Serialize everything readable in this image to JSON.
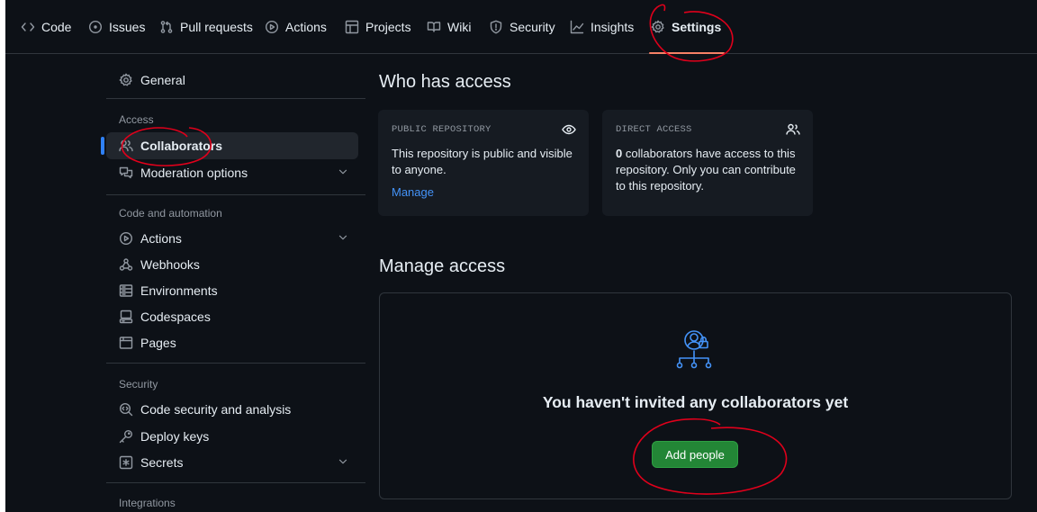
{
  "nav": {
    "tabs": [
      {
        "label": "Code",
        "icon": "code-icon"
      },
      {
        "label": "Issues",
        "icon": "issue-icon"
      },
      {
        "label": "Pull requests",
        "icon": "pull-request-icon"
      },
      {
        "label": "Actions",
        "icon": "play-icon"
      },
      {
        "label": "Projects",
        "icon": "table-icon"
      },
      {
        "label": "Wiki",
        "icon": "book-icon"
      },
      {
        "label": "Security",
        "icon": "shield-icon"
      },
      {
        "label": "Insights",
        "icon": "graph-icon"
      },
      {
        "label": "Settings",
        "icon": "gear-icon",
        "active": true
      }
    ]
  },
  "sidebar": {
    "general": "General",
    "access_heading": "Access",
    "collaborators": "Collaborators",
    "moderation": "Moderation options",
    "code_heading": "Code and automation",
    "actions": "Actions",
    "webhooks": "Webhooks",
    "environments": "Environments",
    "codespaces": "Codespaces",
    "pages": "Pages",
    "security_heading": "Security",
    "code_security": "Code security and analysis",
    "deploy_keys": "Deploy keys",
    "secrets": "Secrets",
    "integrations_heading": "Integrations"
  },
  "main": {
    "who_has_access": "Who has access",
    "public_card": {
      "label": "PUBLIC REPOSITORY",
      "text": "This repository is public and visible to anyone.",
      "link": "Manage"
    },
    "direct_card": {
      "label": "DIRECT ACCESS",
      "count": "0",
      "text": " collaborators have access to this repository. Only you can contribute to this repository."
    },
    "manage_access": "Manage access",
    "empty_text": "You haven't invited any collaborators yet",
    "add_button": "Add people"
  },
  "colors": {
    "background": "#0d1117",
    "accent_blue": "#2f81f7",
    "button_green": "#238636",
    "tab_underline": "#f78166",
    "annotation_red": "#e0001b"
  }
}
